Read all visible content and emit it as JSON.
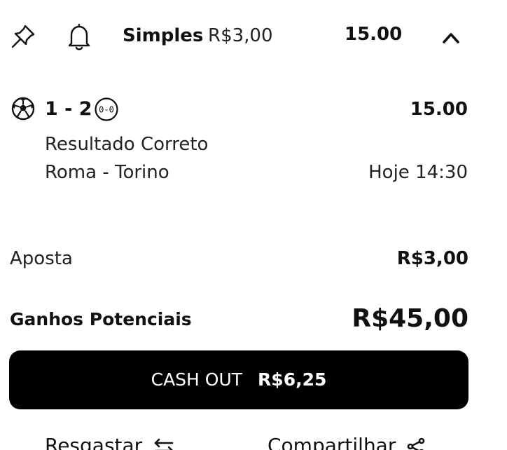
{
  "header": {
    "icons": [
      "pin-icon",
      "bell-icon",
      "chevron-up-icon"
    ],
    "bet_type": "Simples",
    "stake": "R$3,00",
    "total_odds": "15.00"
  },
  "selection": {
    "sport_icon": "football-icon",
    "pick": "1 - 2",
    "live_score_badge": "0-0",
    "odds": "15.00",
    "market": "Resultado Correto",
    "event": "Roma - Torino",
    "time": "Hoje 14:30"
  },
  "summary": {
    "stake_label": "Aposta",
    "stake_value": "R$3,00",
    "winnings_label": "Ganhos Potenciais",
    "winnings_value": "R$45,00"
  },
  "cashout": {
    "label": "CASH OUT",
    "amount": "R$6,25"
  },
  "footer": {
    "left_label": "Resgastar",
    "left_icon": "swap-icon",
    "right_label": "Compartilhar",
    "right_icon": "share-icon"
  },
  "colors": {
    "text": "#111111",
    "button_bg": "#000000",
    "button_text": "#ffffff",
    "background": "#ffffff"
  }
}
